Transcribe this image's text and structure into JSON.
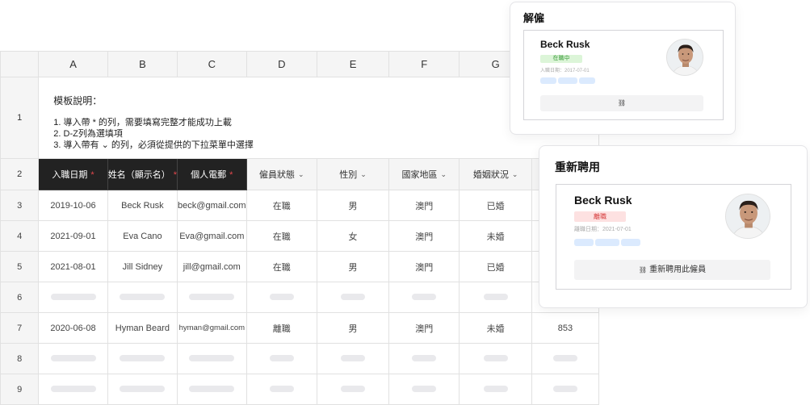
{
  "sheet": {
    "columns": [
      "A",
      "B",
      "C",
      "D",
      "E",
      "F",
      "G"
    ],
    "row_numbers": [
      "1",
      "2",
      "3",
      "4",
      "5",
      "6",
      "7",
      "8",
      "9"
    ],
    "template_note": {
      "title": "模板說明：",
      "lines": [
        "1. 導入帶 * 的列，需要填寫完整才能成功上載",
        "2. D-Z列為選填項",
        "3. 導入帶有 ⌄ 的列，必須從提供的下拉菜單中選擇"
      ]
    },
    "headers": {
      "hire_date": "入職日期",
      "name": "姓名（顯示名）",
      "email": "個人電郵",
      "status": "僱員狀態",
      "gender": "性別",
      "region": "國家地區",
      "marital": "婚姻狀況",
      "required_mark": "*",
      "dropdown_mark": "⌄"
    },
    "rows": [
      {
        "hire_date": "2019-10-06",
        "name": "Beck Rusk",
        "email": "beck@gmail.com",
        "status": "在職",
        "gender": "男",
        "region": "澳門",
        "marital": "已婚",
        "extra": ""
      },
      {
        "hire_date": "2021-09-01",
        "name": "Eva Cano",
        "email": "Eva@gmail.com",
        "status": "在職",
        "gender": "女",
        "region": "澳門",
        "marital": "未婚",
        "extra": ""
      },
      {
        "hire_date": "2021-08-01",
        "name": "Jill Sidney",
        "email": "jill@gmail.com",
        "status": "在職",
        "gender": "男",
        "region": "澳門",
        "marital": "已婚",
        "extra": ""
      },
      {
        "hire_date": "2020-06-08",
        "name": "Hyman Beard",
        "email": "hyman@gmail.com",
        "status": "離職",
        "gender": "男",
        "region": "澳門",
        "marital": "未婚",
        "extra": "853"
      }
    ]
  },
  "dismiss_card": {
    "title": "解僱",
    "employee_name": "Beck Rusk",
    "status_badge": "在職中",
    "date_label": "入職日期：2017-07-01",
    "tag_color": "#dbeafe",
    "action_icon": "link-icon",
    "action_glyph": "⛓"
  },
  "rehire_card": {
    "title": "重新聘用",
    "employee_name": "Beck Rusk",
    "status_badge": "離職",
    "date_label": "離職日期：2021-07-01",
    "tag_color": "#dbeafe",
    "action_icon": "link-icon",
    "action_glyph": "⛓",
    "action_label": "重新聘用此僱員"
  }
}
